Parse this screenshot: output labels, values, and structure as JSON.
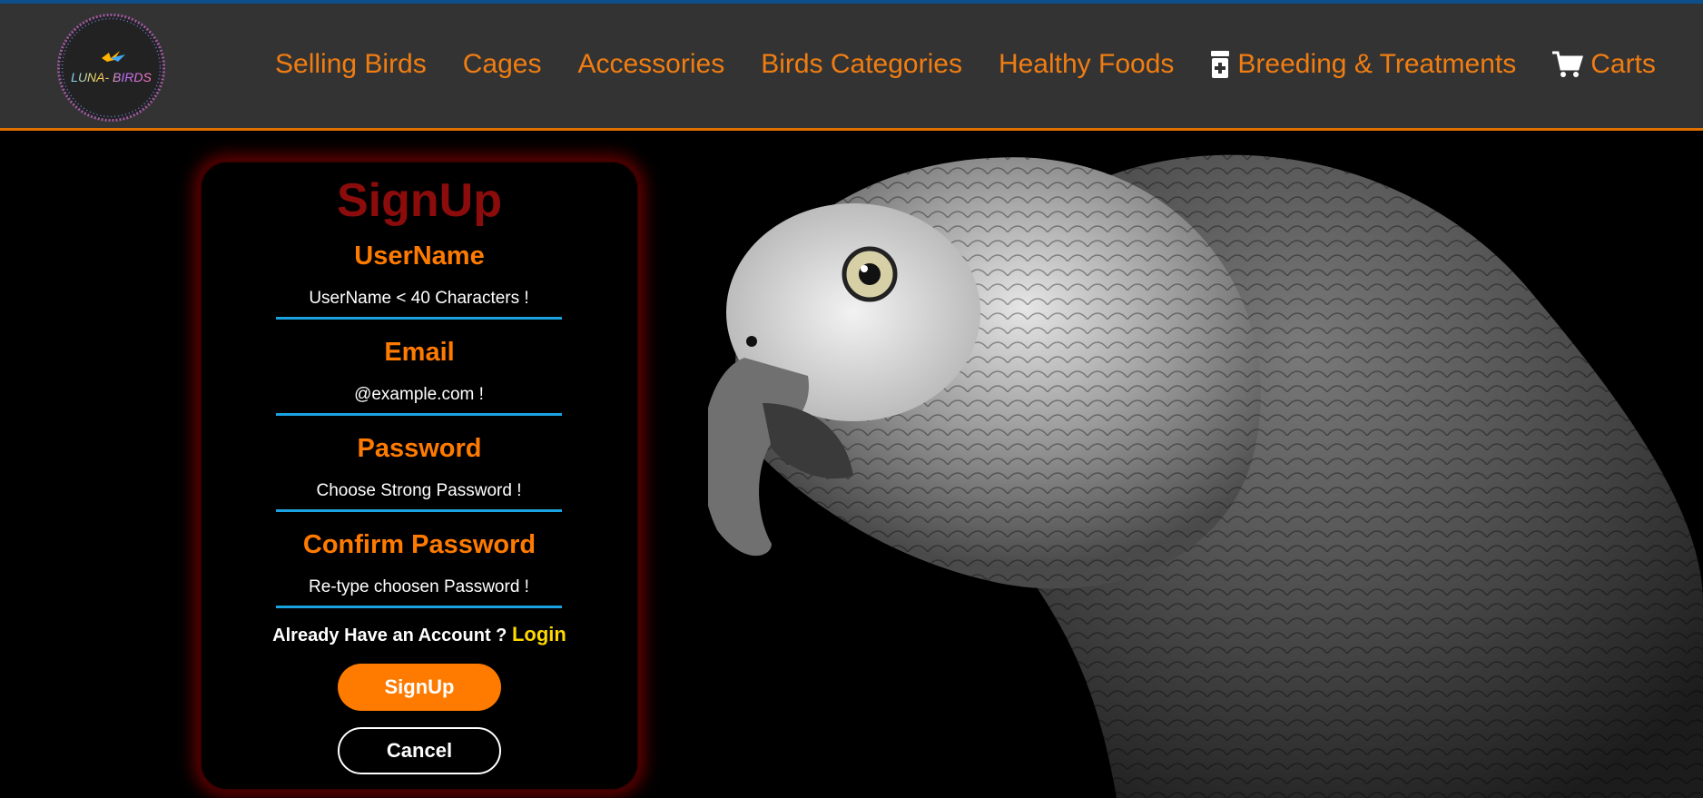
{
  "brand": {
    "logo_text": "LUNA- BIRDS"
  },
  "nav": {
    "items": [
      {
        "label": "Selling Birds"
      },
      {
        "label": "Cages"
      },
      {
        "label": "Accessories"
      },
      {
        "label": "Birds Categories"
      },
      {
        "label": "Healthy Foods"
      },
      {
        "label": "Breeding & Treatments",
        "icon": "medicine-bottle-icon"
      },
      {
        "label": "Carts",
        "icon": "shopping-cart-icon"
      }
    ]
  },
  "form": {
    "title": "SignUp",
    "username": {
      "label": "UserName",
      "placeholder": "UserName < 40 Characters !"
    },
    "email": {
      "label": "Email",
      "placeholder": "@example.com !"
    },
    "password": {
      "label": "Password",
      "placeholder": "Choose Strong Password !"
    },
    "confirm": {
      "label": "Confirm Password",
      "placeholder": "Re-type choosen Password !"
    },
    "account_prompt": "Already Have an Account ?",
    "login_link": "Login",
    "signup_button": "SignUp",
    "cancel_button": "Cancel"
  },
  "colors": {
    "accent": "#ff7b00",
    "title": "#8c0c0c",
    "input_underline": "#1aa3e0",
    "link": "#ffd800",
    "header_bg": "#333333"
  }
}
